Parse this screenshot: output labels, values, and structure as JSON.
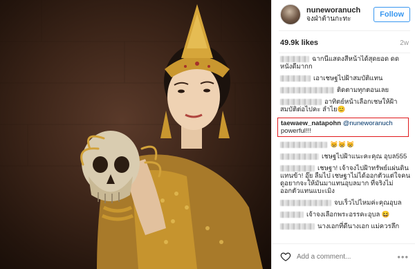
{
  "post": {
    "username": "nuneworanuch",
    "subtitle": "จงฝ่าต้านกะทะ",
    "follow_label": "Follow",
    "likes": "49.9k likes",
    "age": "2w"
  },
  "comments": [
    {
      "text": "ฉากนี้แสดงสีหน้าได้สุดยอด ดด หนังดีมากก"
    },
    {
      "text": "เอาเชษฐไปฝ้าสมบัติแทน"
    },
    {
      "text": "ติดตามทุกตอนเลย"
    },
    {
      "text": "อาทิตย์หน้าเลือกเชษให้ฝ้า สมบัติต่อไปคะ ลำไย😊"
    },
    {
      "user": "taewaew_natapohn",
      "mention": "@nuneworanuch",
      "text": "powerful!!!"
    },
    {
      "text": "😸😸😸"
    },
    {
      "text": "เชษฐไปฝ้าแนะคะคุณ อุบล555"
    },
    {
      "text": "เชษฐา! เจ้าจงไปฝ้าทรัพย์แผ่นดินแทนข้า! อุ๊ย ลืมไป เชษฐาไม่ได้ออกตัวแต่ใจคนดูอยากจะให้มันมาแทนอุบลมาก ที่จริงไม่ออกตัวแทนแบะเมิง"
    },
    {
      "text": "จบเร็วไปไหมค่ะคุณอุบล"
    },
    {
      "text": "เจ้าจงเลือกพระอรรคะอุบล 😆"
    },
    {
      "text": "นางเอกที่ดีนางเอก แม่ควรลึก"
    }
  ],
  "comment_box": {
    "placeholder": "Add a comment..."
  },
  "more_label": "•••",
  "colors": {
    "follow": "#3897f0",
    "highlight": "#e0191c",
    "gold": "#c9972f"
  },
  "icons": {
    "like": "heart-outline-icon",
    "more": "more-options-icon"
  }
}
